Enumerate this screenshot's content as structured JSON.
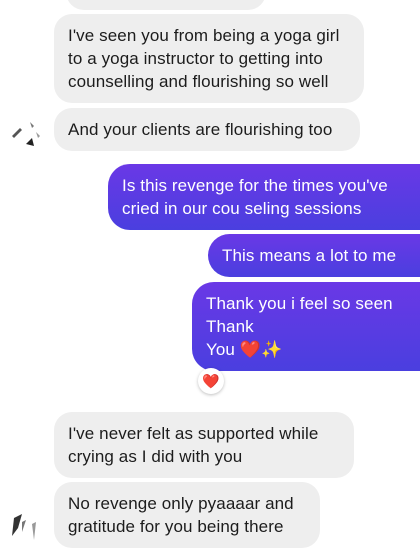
{
  "messages": [
    {
      "id": "m1",
      "direction": "incoming",
      "text": "I've seen you from being a yoga girl\nto a yoga instructor to getting into\ncounselling and flourishing so well"
    },
    {
      "id": "m2",
      "direction": "incoming",
      "text": "And your clients are flourishing too"
    },
    {
      "id": "m3",
      "direction": "outgoing",
      "text": "Is this revenge for the times you've\ncried in our cou seling sessions"
    },
    {
      "id": "m4",
      "direction": "outgoing",
      "text": "This means a lot to me"
    },
    {
      "id": "m5",
      "direction": "outgoing",
      "text": "Thank you i feel so seen\nThank\n You ❤️✨"
    },
    {
      "id": "m6",
      "direction": "incoming",
      "text": "I've never felt as supported while\ncrying as I did with you"
    },
    {
      "id": "m7",
      "direction": "incoming",
      "text": "No revenge only pyaaaar and\ngratitude for you being there"
    }
  ],
  "reactions": [
    {
      "on": "m5",
      "emoji": "❤️"
    }
  ],
  "colors": {
    "incoming_bubble": "#eeeeee",
    "outgoing_bubble_top": "#6a38e6",
    "outgoing_bubble_bottom": "#4a3fdf",
    "incoming_text": "#1c1c1c",
    "outgoing_text": "#ffffff",
    "reaction_heart": "#e8344e"
  }
}
